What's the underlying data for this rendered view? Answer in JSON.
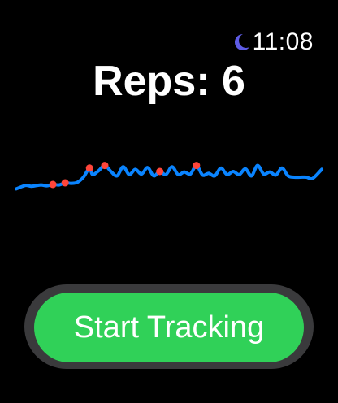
{
  "status": {
    "focus_icon": "moon-icon",
    "time": "11:08"
  },
  "title": "Reps: 6",
  "chart_data": {
    "type": "line",
    "title": "",
    "xlabel": "",
    "ylabel": "",
    "x": [
      0,
      3,
      5,
      8,
      10,
      12,
      14,
      16,
      18,
      20,
      22,
      24,
      25,
      27,
      29,
      31,
      33,
      35,
      37,
      39,
      41,
      43,
      45,
      47,
      49,
      51,
      53,
      55,
      57,
      59,
      61,
      63,
      65,
      67,
      69,
      71,
      73,
      75,
      77,
      79,
      81,
      83,
      85,
      87,
      89,
      91,
      93,
      95,
      97,
      100
    ],
    "y": [
      0.05,
      0.18,
      0.15,
      0.2,
      0.17,
      0.22,
      0.2,
      0.28,
      0.26,
      0.3,
      0.5,
      0.85,
      0.6,
      0.75,
      0.95,
      0.72,
      0.55,
      0.9,
      0.6,
      0.8,
      0.62,
      0.87,
      0.55,
      0.72,
      0.6,
      0.9,
      0.6,
      0.7,
      0.62,
      0.95,
      0.58,
      0.65,
      0.55,
      0.85,
      0.6,
      0.72,
      0.6,
      0.82,
      0.55,
      0.95,
      0.62,
      0.7,
      0.58,
      0.85,
      0.55,
      0.5,
      0.5,
      0.5,
      0.45,
      0.8
    ],
    "peaks": [
      11,
      14,
      25,
      32,
      48,
      61
    ],
    "line_color": "#0a84ff",
    "peak_color": "#ff453a",
    "grid": false,
    "axes_visible": false
  },
  "button": {
    "label": "Start Tracking",
    "color": "#30d158"
  },
  "colors": {
    "background": "#000000",
    "moon": "#5e5ce6",
    "button_well": "#3a3a3c"
  }
}
